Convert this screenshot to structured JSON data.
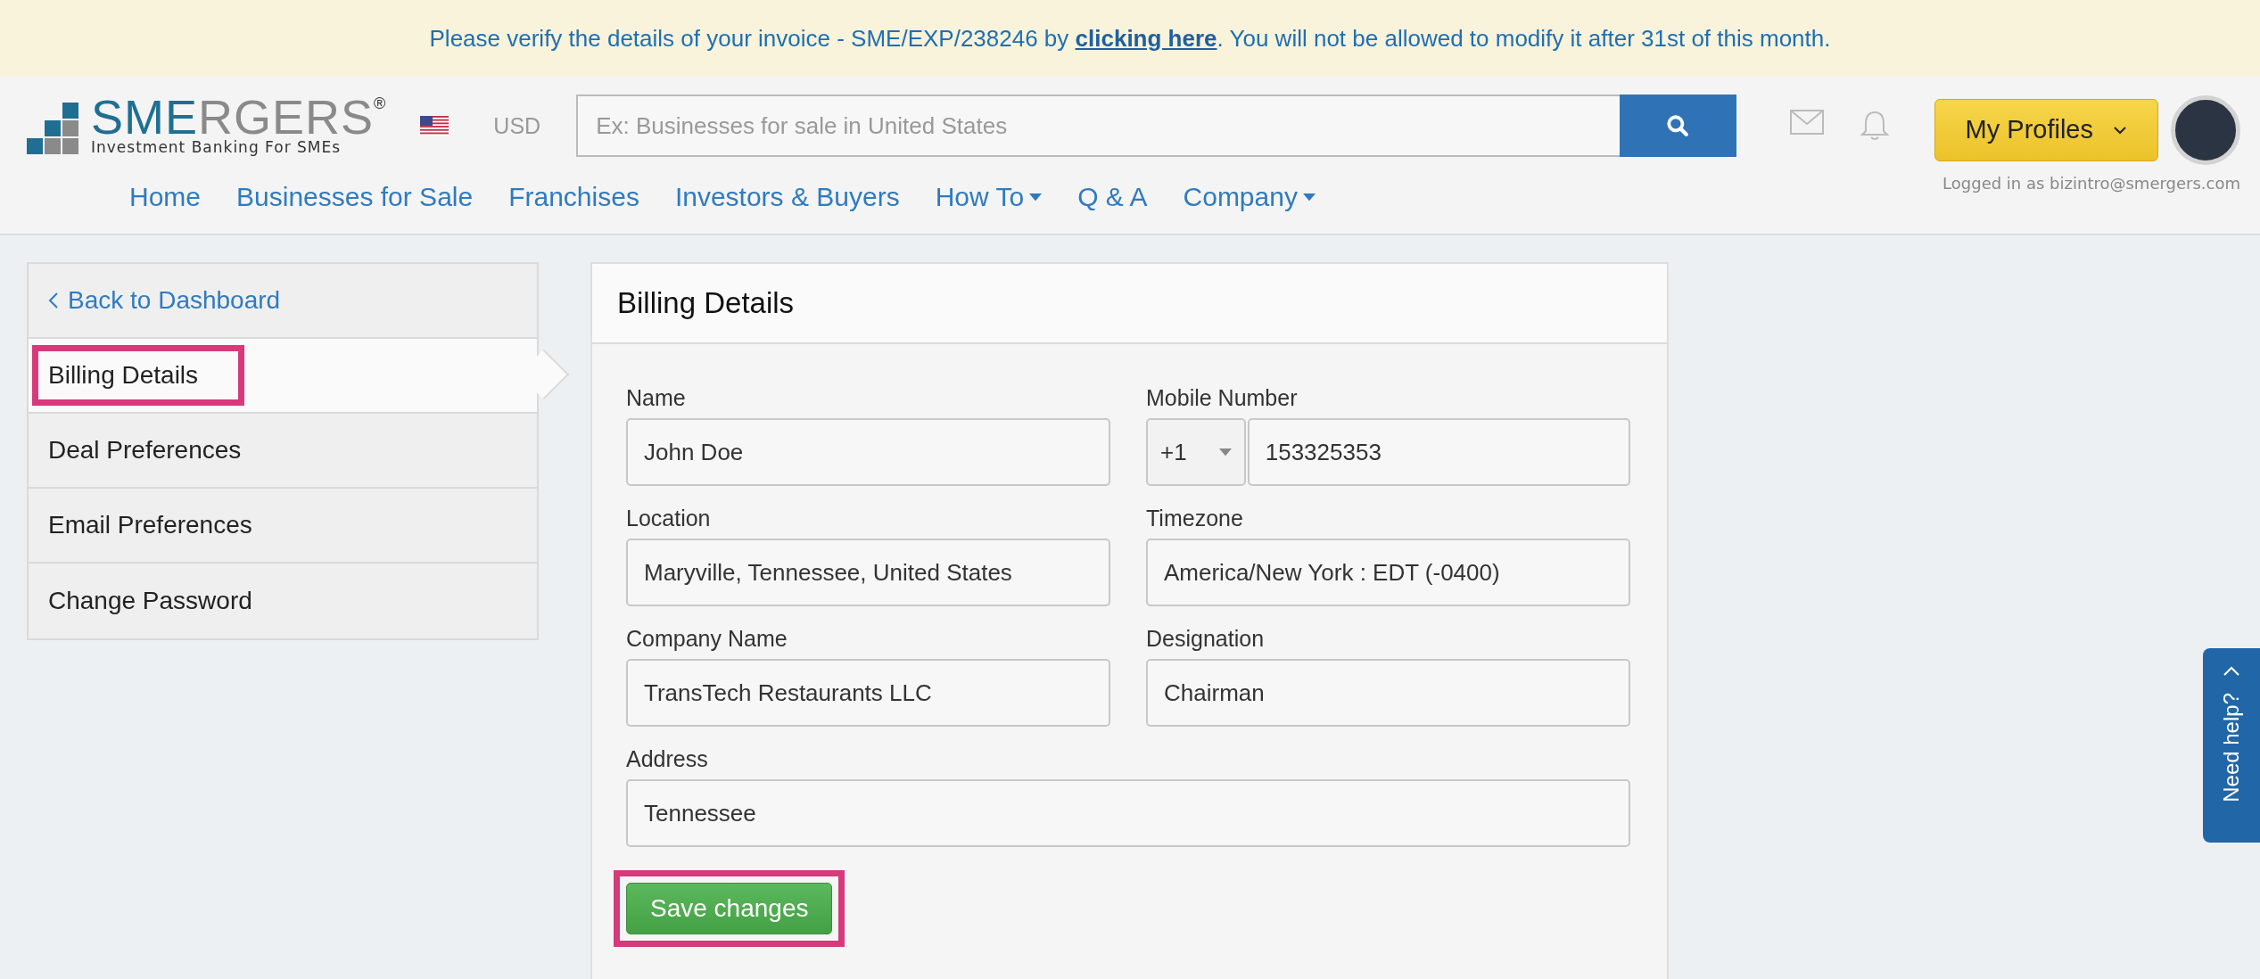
{
  "banner": {
    "before": "Please verify the details of your invoice - SME/EXP/238246 by ",
    "link": "clicking here",
    "after": ". You will not be allowed to modify it after 31st of this month."
  },
  "header": {
    "logo_primary": "SME",
    "logo_secondary": "RGERS",
    "registered": "®",
    "tagline": "Investment Banking For SMEs",
    "currency": "USD",
    "search": {
      "placeholder": "Ex: Businesses for sale in United States"
    },
    "profiles_button": "My Profiles",
    "logged_in": "Logged in as bizintro@smergers.com"
  },
  "nav": [
    {
      "label": "Home",
      "dropdown": false
    },
    {
      "label": "Businesses for Sale",
      "dropdown": false
    },
    {
      "label": "Franchises",
      "dropdown": false
    },
    {
      "label": "Investors & Buyers",
      "dropdown": false
    },
    {
      "label": "How To",
      "dropdown": true
    },
    {
      "label": "Q & A",
      "dropdown": false
    },
    {
      "label": "Company",
      "dropdown": true
    }
  ],
  "sidebar": {
    "back": "Back to Dashboard",
    "items": [
      {
        "label": "Billing Details",
        "selected": true,
        "highlighted": true
      },
      {
        "label": "Deal Preferences",
        "selected": false,
        "highlighted": false
      },
      {
        "label": "Email Preferences",
        "selected": false,
        "highlighted": false
      },
      {
        "label": "Change Password",
        "selected": false,
        "highlighted": false
      }
    ]
  },
  "card": {
    "title": "Billing Details",
    "fields": [
      {
        "kind": "text",
        "label": "Name",
        "value": "John Doe",
        "wide": false
      },
      {
        "kind": "phone",
        "label": "Mobile Number",
        "code": "+1",
        "value": "153325353",
        "wide": false
      },
      {
        "kind": "text",
        "label": "Location",
        "value": "Maryville, Tennessee, United States",
        "wide": false
      },
      {
        "kind": "text",
        "label": "Timezone",
        "value": "America/New York : EDT (-0400)",
        "wide": false
      },
      {
        "kind": "text",
        "label": "Company Name",
        "value": "TransTech Restaurants LLC",
        "wide": false
      },
      {
        "kind": "text",
        "label": "Designation",
        "value": "Chairman",
        "wide": false
      },
      {
        "kind": "text",
        "label": "Address",
        "value": "Tennessee",
        "wide": true
      }
    ],
    "save": {
      "label": "Save changes",
      "highlighted": true
    }
  },
  "help": "Need help?"
}
